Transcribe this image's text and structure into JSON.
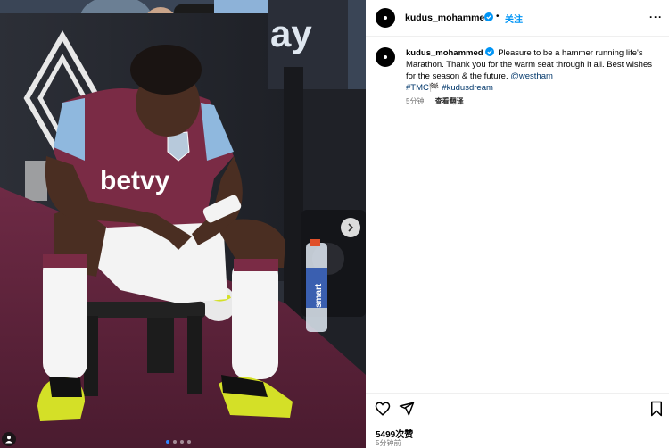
{
  "post": {
    "username": "kudus_mohammed",
    "follow_label": "关注",
    "separator": "•",
    "more_label": "···",
    "caption_username": "kudus_mohammed",
    "caption_text": "Pleasure to be a hammer running life's Marathon. Thank you for the warm seat through it all. Best wishes for the season & the future.",
    "caption_mention": "@westham",
    "caption_hashtags": "#TMC🏁 #kudusdream",
    "comment_time": "5分钟",
    "translate_label": "查看翻译",
    "likes": "5499次赞",
    "posted_time": "5分钟前"
  },
  "photo": {
    "jersey_sponsor": "betvy",
    "bottle_label": "smart",
    "board_text": "ay",
    "carousel": {
      "count": 4,
      "active_index": 0
    }
  },
  "icons": [
    "verified-icon",
    "heart-icon",
    "share-icon",
    "bookmark-icon",
    "next-arrow-icon",
    "user-tag-icon",
    "more-icon"
  ],
  "colors": {
    "follow": "#0095f6",
    "link": "#00376b",
    "verified": "#0095f6",
    "kit_claret": "#7a2b45",
    "kit_blue": "#8fb8de",
    "boots": "#d4e027"
  }
}
